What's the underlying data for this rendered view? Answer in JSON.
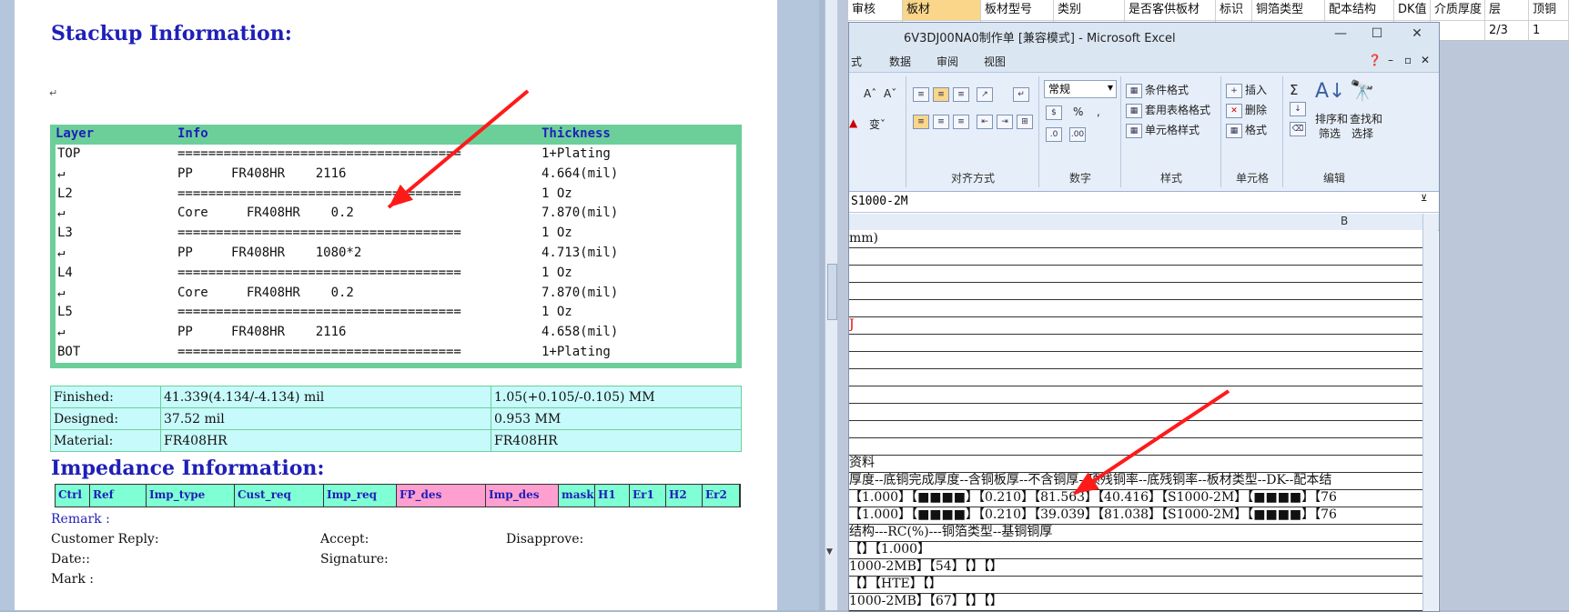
{
  "word": {
    "stackup_title": "Stackup Information:",
    "stackup_headers": {
      "layer": "Layer",
      "info": "Info",
      "thickness": "Thickness"
    },
    "stackup_rows": [
      {
        "layer": "TOP",
        "info": "=====================================",
        "thickness": "1+Plating"
      },
      {
        "layer": "",
        "info": "PP     FR408HR    2116",
        "thickness": "4.664(mil)"
      },
      {
        "layer": "L2",
        "info": "=====================================",
        "thickness": "1 Oz"
      },
      {
        "layer": "",
        "info": "Core     FR408HR    0.2",
        "thickness": "7.870(mil)"
      },
      {
        "layer": "L3",
        "info": "=====================================",
        "thickness": "1 Oz"
      },
      {
        "layer": "",
        "info": "PP     FR408HR    1080*2",
        "thickness": "4.713(mil)"
      },
      {
        "layer": "L4",
        "info": "=====================================",
        "thickness": "1 Oz"
      },
      {
        "layer": "",
        "info": "Core     FR408HR    0.2",
        "thickness": "7.870(mil)"
      },
      {
        "layer": "L5",
        "info": "=====================================",
        "thickness": "1 Oz"
      },
      {
        "layer": "",
        "info": "PP     FR408HR    2116",
        "thickness": "4.658(mil)"
      },
      {
        "layer": "BOT",
        "info": "=====================================",
        "thickness": "1+Plating"
      }
    ],
    "finish_rows": [
      {
        "label": "Finished:",
        "mil": "41.339(4.134/-4.134) mil",
        "mm": "1.05(+0.105/-0.105) MM"
      },
      {
        "label": "Designed:",
        "mil": "37.52 mil",
        "mm": "0.953 MM"
      },
      {
        "label": "Material:",
        "mil": "FR408HR",
        "mm": "FR408HR"
      }
    ],
    "impedance_title": "Impedance Information:",
    "impedance_cols": [
      "Ctrl",
      "Ref",
      "Imp_type",
      "Cust_req",
      "Imp_req",
      "FP_des",
      "Imp_des",
      "mask",
      "H1",
      "Er1",
      "H2",
      "Er2"
    ],
    "remark": "Remark :",
    "customer_reply": "Customer Reply:",
    "accept": "Accept:",
    "disapprove": "Disapprove:",
    "date": "Date::",
    "signature": "Signature:",
    "mark": "Mark :"
  },
  "excel_behind": {
    "headers": [
      "审核",
      "板材",
      "板材型号",
      "类别",
      "是否客供板材",
      "标识",
      "铜箔类型",
      "配本结构",
      "DK值",
      "介质厚度",
      "层",
      "顶铜"
    ],
    "row2": [
      "",
      "",
      "",
      "",
      "",
      "",
      "",
      "",
      "",
      "",
      "2/3",
      "1"
    ]
  },
  "excel": {
    "title": "6V3DJ00NA0制作单  [兼容模式] - Microsoft Excel",
    "tabs": [
      "式",
      "数据",
      "审阅",
      "视图"
    ],
    "font_size_a": "A",
    "number_format": "常规",
    "groups": {
      "align": "对齐方式",
      "number": "数字",
      "style": "样式",
      "cells": "单元格",
      "edit": "编辑"
    },
    "style_buttons": [
      "条件格式",
      "套用表格格式",
      "单元格样式"
    ],
    "cell_buttons": [
      "插入",
      "删除",
      "格式"
    ],
    "edit_buttons": {
      "sort": "排序和",
      "sort2": "筛选",
      "find": "查找和",
      "find2": "选择"
    },
    "percent": "%",
    "comma": ",",
    "formula_text": "S1000-2M",
    "col_b": "B",
    "rows": [
      "mm)",
      "",
      "",
      "",
      "",
      "J",
      "",
      "",
      "",
      "",
      "",
      "",
      "",
      "资料",
      "厚度--底铜完成厚度--含铜板厚--不含铜厚--顶残铜率--底残铜率--板材类型--DK--配本结",
      "【1.000】【■■■■】【0.210】【81.563】【40.416】【S1000-2M】【■■■■】【76",
      "【1.000】【■■■■】【0.210】【39.039】【81.038】【S1000-2M】【■■■■】【76",
      "结构---RC(%)---铜箔类型--基铜铜厚",
      "【】【1.000】",
      "1000-2MB】【54】【】【】",
      "【】【HTE】【】",
      "1000-2MB】【67】【】【】"
    ]
  },
  "colors": {
    "arrow": "#ff1a1a",
    "table_green": "#6ccf9a",
    "cyan": "#c7fafa",
    "pink": "#ff9fcf",
    "heading_blue": "#1f1fb8"
  }
}
